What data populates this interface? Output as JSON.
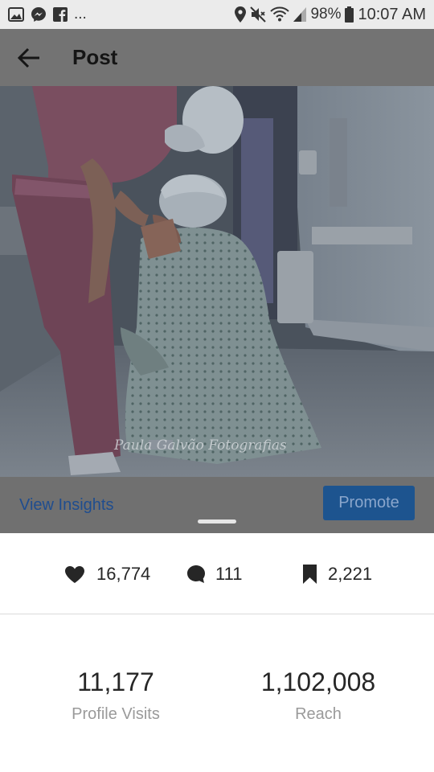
{
  "status_bar": {
    "left_icons": [
      "image-icon",
      "messenger-icon",
      "facebook-icon"
    ],
    "more": "...",
    "battery": "98%",
    "time": "10:07 AM"
  },
  "header": {
    "title": "Post"
  },
  "photo": {
    "watermark": "Paula Galvão Fotografias"
  },
  "actions": {
    "view_insights": "View Insights",
    "promote": "Promote"
  },
  "engagement": {
    "likes": "16,774",
    "comments": "111",
    "saves": "2,221"
  },
  "metrics": [
    {
      "value": "11,177",
      "label": "Profile Visits"
    },
    {
      "value": "1,102,008",
      "label": "Reach"
    }
  ],
  "colors": {
    "accent": "#1d548f",
    "link": "#1f4d8f",
    "overlay": "#737373"
  }
}
